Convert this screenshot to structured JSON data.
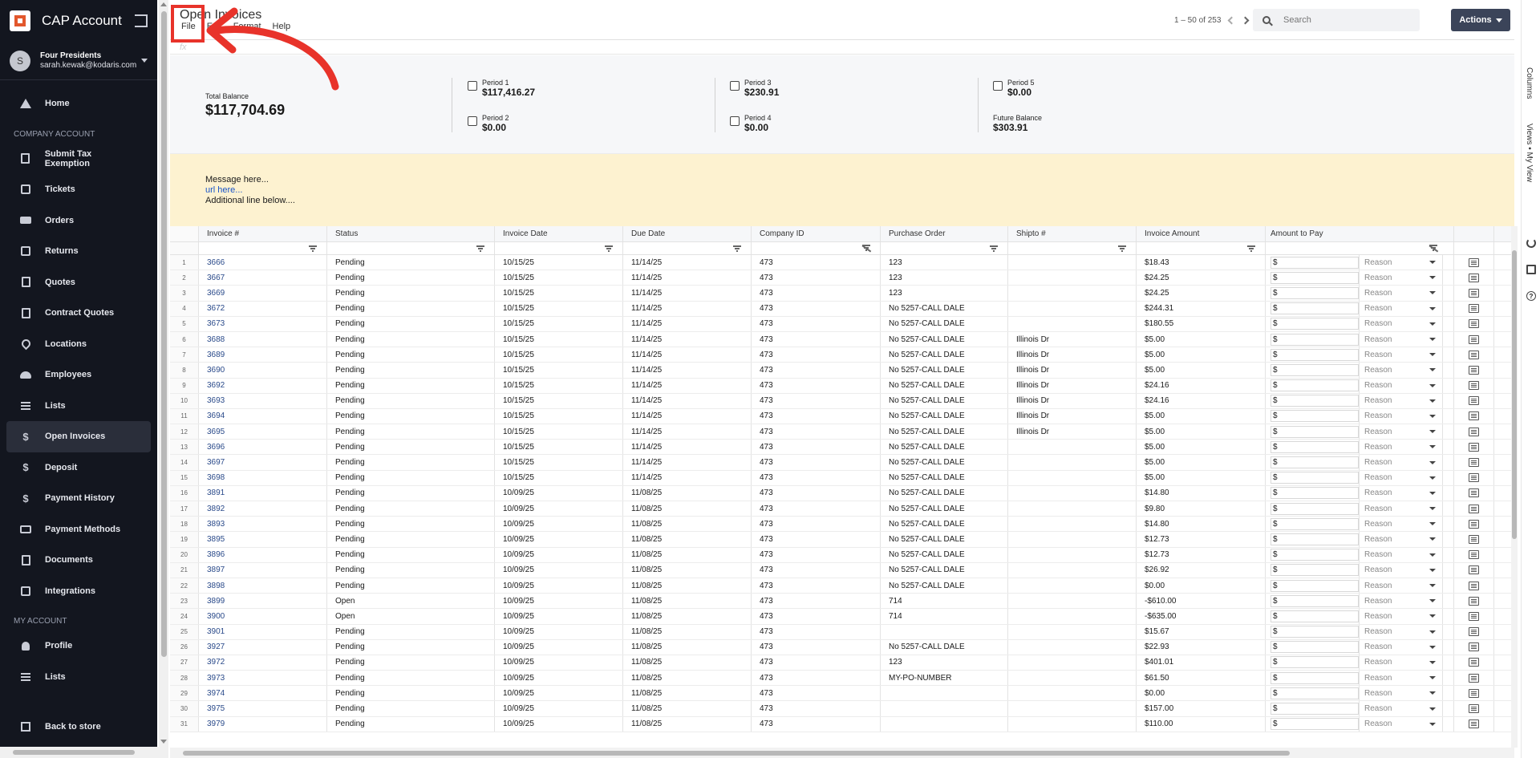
{
  "sidebar": {
    "app_title": "CAP Account",
    "user": {
      "initial": "S",
      "name": "Four Presidents",
      "email": "sarah.kewak@kodaris.com"
    },
    "sections": {
      "top": [
        {
          "label": "Home",
          "icon": "home-icon"
        }
      ],
      "company_header": "COMPANY ACCOUNT",
      "company": [
        {
          "label": "Submit Tax Exemption",
          "icon": "document-icon"
        },
        {
          "label": "Tickets",
          "icon": "ticket-icon"
        },
        {
          "label": "Orders",
          "icon": "truck-icon"
        },
        {
          "label": "Returns",
          "icon": "return-box-icon"
        },
        {
          "label": "Quotes",
          "icon": "clipboard-icon"
        },
        {
          "label": "Contract Quotes",
          "icon": "clipboard-icon"
        },
        {
          "label": "Locations",
          "icon": "location-pin-icon"
        },
        {
          "label": "Employees",
          "icon": "people-icon"
        },
        {
          "label": "Lists",
          "icon": "list-icon"
        },
        {
          "label": "Open Invoices",
          "icon": "dollar-icon",
          "active": true
        },
        {
          "label": "Deposit",
          "icon": "dollar-icon"
        },
        {
          "label": "Payment History",
          "icon": "dollar-icon"
        },
        {
          "label": "Payment Methods",
          "icon": "credit-card-icon"
        },
        {
          "label": "Documents",
          "icon": "document-icon"
        },
        {
          "label": "Integrations",
          "icon": "integration-icon"
        }
      ],
      "account_header": "MY ACCOUNT",
      "account": [
        {
          "label": "Profile",
          "icon": "person-icon"
        },
        {
          "label": "Lists",
          "icon": "list-icon"
        }
      ]
    },
    "back_to_store": "Back to store"
  },
  "header": {
    "title": "Open Invoices",
    "menu": [
      "File",
      "Edit",
      "Format",
      "Help"
    ],
    "pager_text": "1 – 50 of 253",
    "search_placeholder": "Search",
    "actions_label": "Actions",
    "formula_placeholder": "fx"
  },
  "summary": {
    "total_label": "Total Balance",
    "total_amount": "$117,704.69",
    "periods": [
      {
        "label": "Period 1",
        "amount": "$117,416.27"
      },
      {
        "label": "Period 2",
        "amount": "$0.00"
      },
      {
        "label": "Period 3",
        "amount": "$230.91"
      },
      {
        "label": "Period 4",
        "amount": "$0.00"
      },
      {
        "label": "Period 5",
        "amount": "$0.00"
      }
    ],
    "future_label": "Future Balance",
    "future_amount": "$303.91"
  },
  "banner": {
    "line1": "Message here...",
    "link": "url here...",
    "line3": "Additional line below...."
  },
  "table": {
    "columns": [
      "Invoice #",
      "Status",
      "Invoice Date",
      "Due Date",
      "Company ID",
      "Purchase Order",
      "Shipto #",
      "Invoice Amount",
      "Amount to Pay"
    ],
    "pay_prefix": "$",
    "reason_placeholder": "Reason",
    "rows": [
      [
        "1",
        "3666",
        "Pending",
        "10/15/25",
        "11/14/25",
        "473",
        "123",
        "",
        "$18.43"
      ],
      [
        "2",
        "3667",
        "Pending",
        "10/15/25",
        "11/14/25",
        "473",
        "123",
        "",
        "$24.25"
      ],
      [
        "3",
        "3669",
        "Pending",
        "10/15/25",
        "11/14/25",
        "473",
        "123",
        "",
        "$24.25"
      ],
      [
        "4",
        "3672",
        "Pending",
        "10/15/25",
        "11/14/25",
        "473",
        "No 5257-CALL DALE",
        "",
        "$244.31"
      ],
      [
        "5",
        "3673",
        "Pending",
        "10/15/25",
        "11/14/25",
        "473",
        "No 5257-CALL DALE",
        "",
        "$180.55"
      ],
      [
        "6",
        "3688",
        "Pending",
        "10/15/25",
        "11/14/25",
        "473",
        "No 5257-CALL DALE",
        "Illinois Dr",
        "$5.00"
      ],
      [
        "7",
        "3689",
        "Pending",
        "10/15/25",
        "11/14/25",
        "473",
        "No 5257-CALL DALE",
        "Illinois Dr",
        "$5.00"
      ],
      [
        "8",
        "3690",
        "Pending",
        "10/15/25",
        "11/14/25",
        "473",
        "No 5257-CALL DALE",
        "Illinois Dr",
        "$5.00"
      ],
      [
        "9",
        "3692",
        "Pending",
        "10/15/25",
        "11/14/25",
        "473",
        "No 5257-CALL DALE",
        "Illinois Dr",
        "$24.16"
      ],
      [
        "10",
        "3693",
        "Pending",
        "10/15/25",
        "11/14/25",
        "473",
        "No 5257-CALL DALE",
        "Illinois Dr",
        "$24.16"
      ],
      [
        "11",
        "3694",
        "Pending",
        "10/15/25",
        "11/14/25",
        "473",
        "No 5257-CALL DALE",
        "Illinois Dr",
        "$5.00"
      ],
      [
        "12",
        "3695",
        "Pending",
        "10/15/25",
        "11/14/25",
        "473",
        "No 5257-CALL DALE",
        "Illinois Dr",
        "$5.00"
      ],
      [
        "13",
        "3696",
        "Pending",
        "10/15/25",
        "11/14/25",
        "473",
        "No 5257-CALL DALE",
        "",
        "$5.00"
      ],
      [
        "14",
        "3697",
        "Pending",
        "10/15/25",
        "11/14/25",
        "473",
        "No 5257-CALL DALE",
        "",
        "$5.00"
      ],
      [
        "15",
        "3698",
        "Pending",
        "10/15/25",
        "11/14/25",
        "473",
        "No 5257-CALL DALE",
        "",
        "$5.00"
      ],
      [
        "16",
        "3891",
        "Pending",
        "10/09/25",
        "11/08/25",
        "473",
        "No 5257-CALL DALE",
        "",
        "$14.80"
      ],
      [
        "17",
        "3892",
        "Pending",
        "10/09/25",
        "11/08/25",
        "473",
        "No 5257-CALL DALE",
        "",
        "$9.80"
      ],
      [
        "18",
        "3893",
        "Pending",
        "10/09/25",
        "11/08/25",
        "473",
        "No 5257-CALL DALE",
        "",
        "$14.80"
      ],
      [
        "19",
        "3895",
        "Pending",
        "10/09/25",
        "11/08/25",
        "473",
        "No 5257-CALL DALE",
        "",
        "$12.73"
      ],
      [
        "20",
        "3896",
        "Pending",
        "10/09/25",
        "11/08/25",
        "473",
        "No 5257-CALL DALE",
        "",
        "$12.73"
      ],
      [
        "21",
        "3897",
        "Pending",
        "10/09/25",
        "11/08/25",
        "473",
        "No 5257-CALL DALE",
        "",
        "$26.92"
      ],
      [
        "22",
        "3898",
        "Pending",
        "10/09/25",
        "11/08/25",
        "473",
        "No 5257-CALL DALE",
        "",
        "$0.00"
      ],
      [
        "23",
        "3899",
        "Open",
        "10/09/25",
        "11/08/25",
        "473",
        "714",
        "",
        "-$610.00"
      ],
      [
        "24",
        "3900",
        "Open",
        "10/09/25",
        "11/08/25",
        "473",
        "714",
        "",
        "-$635.00"
      ],
      [
        "25",
        "3901",
        "Pending",
        "10/09/25",
        "11/08/25",
        "473",
        "",
        "",
        "$15.67"
      ],
      [
        "26",
        "3927",
        "Pending",
        "10/09/25",
        "11/08/25",
        "473",
        "No 5257-CALL DALE",
        "",
        "$22.93"
      ],
      [
        "27",
        "3972",
        "Pending",
        "10/09/25",
        "11/08/25",
        "473",
        "123",
        "",
        "$401.01"
      ],
      [
        "28",
        "3973",
        "Pending",
        "10/09/25",
        "11/08/25",
        "473",
        "MY-PO-NUMBER",
        "",
        "$61.50"
      ],
      [
        "29",
        "3974",
        "Pending",
        "10/09/25",
        "11/08/25",
        "473",
        "",
        "",
        "$0.00"
      ],
      [
        "30",
        "3975",
        "Pending",
        "10/09/25",
        "11/08/25",
        "473",
        "",
        "",
        "$157.00"
      ],
      [
        "31",
        "3979",
        "Pending",
        "10/09/25",
        "11/08/25",
        "473",
        "",
        "",
        "$110.00"
      ]
    ]
  },
  "right_rail": {
    "columns_label": "Columns",
    "views_label": "Views • My View"
  },
  "colors": {
    "sidebar_bg": "#13161f",
    "accent": "#e2572c",
    "actions_bg": "#3b4459",
    "banner_bg": "#fdf2d0",
    "annotation": "#e8332a"
  }
}
